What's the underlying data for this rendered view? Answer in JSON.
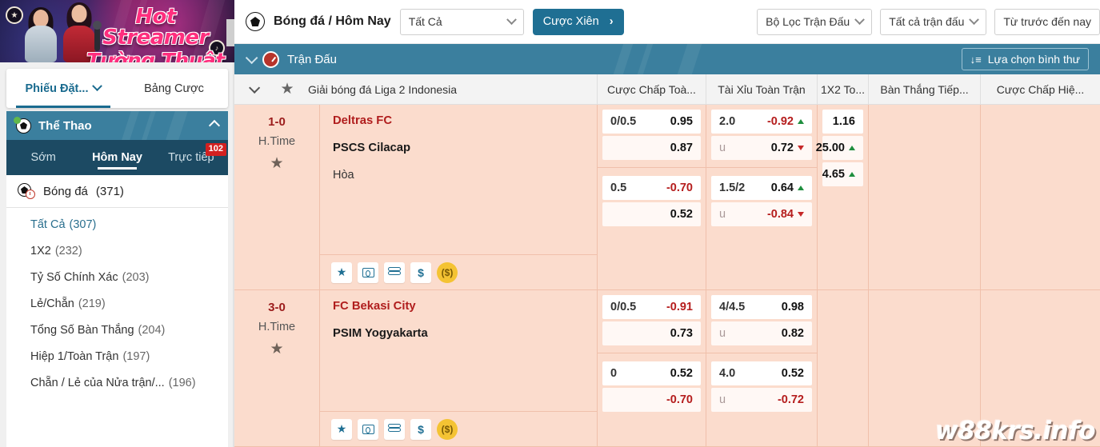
{
  "sidebar": {
    "banner": {
      "line1": "Hot Streamer",
      "line2": "Tường Thuật"
    },
    "betslip": {
      "active_tab": "Phiếu Đặt...",
      "other_tab": "Bảng Cược"
    },
    "sport_header": {
      "title": "Thể Thao",
      "collapse_icon": "chevron-up-icon"
    },
    "sub_tabs": [
      {
        "label": "Sớm",
        "active": false,
        "badge": ""
      },
      {
        "label": "Hôm Nay",
        "active": true,
        "badge": ""
      },
      {
        "label": "Trực tiếp",
        "active": false,
        "badge": "102"
      }
    ],
    "sport_row": {
      "label": "Bóng đá",
      "count": "(371)"
    },
    "menu": [
      {
        "label": "Tất Cả",
        "count": "(307)"
      },
      {
        "label": "1X2",
        "count": "(232)"
      },
      {
        "label": "Tỷ Số Chính Xác",
        "count": "(203)"
      },
      {
        "label": "Lẻ/Chẵn",
        "count": "(219)"
      },
      {
        "label": "Tổng Số Bàn Thắng",
        "count": "(204)"
      },
      {
        "label": "Hiệp 1/Toàn Trận",
        "count": "(197)"
      },
      {
        "label": "Chẵn / Lẻ của Nửa trận/...",
        "count": "(196)"
      }
    ]
  },
  "topbar": {
    "breadcrumb": "Bóng đá / Hôm Nay",
    "select_all": "Tất Cả",
    "parlay_button": "Cược Xiên",
    "filter_match": "Bộ Lọc Trận Đấu",
    "filter_all_matches": "Tất cả trận đấu",
    "filter_time": "Từ trước đến nay"
  },
  "match_bar": {
    "title": "Trận Đấu",
    "normal_option_button": "Lựa chọn bình thư"
  },
  "column_headers": {
    "league": "Giải bóng đá Liga 2 Indonesia",
    "cols": [
      "Cược Chấp Toà...",
      "Tài Xỉu Toàn Trận",
      "1X2 To...",
      "Bàn Thắng Tiếp...",
      "Cược Chấp Hiệ..."
    ]
  },
  "matches": [
    {
      "score": "1-0",
      "period": "H.Time",
      "home": "Deltras FC",
      "away": "PSCS Cilacap",
      "draw": "Hòa",
      "handicap": {
        "top": {
          "line": "0/0.5",
          "odd": "0.95",
          "negative": false,
          "trend": ""
        },
        "bottom": {
          "line": "",
          "odd": "0.87",
          "negative": false,
          "trend": ""
        },
        "top2": {
          "line": "0.5",
          "odd": "-0.70",
          "negative": true,
          "trend": ""
        },
        "bottom2": {
          "line": "",
          "odd": "0.52",
          "negative": false,
          "trend": ""
        }
      },
      "overunder": {
        "top": {
          "line": "2.0",
          "odd": "-0.92",
          "negative": true,
          "trend": "up"
        },
        "bottom": {
          "line": "u",
          "odd": "0.72",
          "negative": false,
          "trend": "down"
        },
        "top2": {
          "line": "1.5/2",
          "odd": "0.64",
          "negative": false,
          "trend": "up"
        },
        "bottom2": {
          "line": "u",
          "odd": "-0.84",
          "negative": true,
          "trend": "down"
        }
      },
      "x12": [
        {
          "odd": "1.16",
          "trend": ""
        },
        {
          "odd": "25.00",
          "trend": "up"
        },
        {
          "odd": "4.65",
          "trend": "up"
        }
      ],
      "actions": [
        "star-icon",
        "pitch-icon",
        "stats-icon",
        "dollar-icon",
        "cashout-coin-icon"
      ]
    },
    {
      "score": "3-0",
      "period": "H.Time",
      "home": "FC Bekasi City",
      "away": "PSIM Yogyakarta",
      "draw": "",
      "handicap": {
        "top": {
          "line": "0/0.5",
          "odd": "-0.91",
          "negative": true,
          "trend": ""
        },
        "bottom": {
          "line": "",
          "odd": "0.73",
          "negative": false,
          "trend": ""
        },
        "top2": {
          "line": "0",
          "odd": "0.52",
          "negative": false,
          "trend": ""
        },
        "bottom2": {
          "line": "",
          "odd": "-0.70",
          "negative": true,
          "trend": ""
        }
      },
      "overunder": {
        "top": {
          "line": "4/4.5",
          "odd": "0.98",
          "negative": false,
          "trend": ""
        },
        "bottom": {
          "line": "u",
          "odd": "0.82",
          "negative": false,
          "trend": ""
        },
        "top2": {
          "line": "4.0",
          "odd": "0.52",
          "negative": false,
          "trend": ""
        },
        "bottom2": {
          "line": "u",
          "odd": "-0.72",
          "negative": true,
          "trend": ""
        }
      },
      "x12": [],
      "actions": [
        "star-icon",
        "pitch-icon",
        "stats-icon",
        "dollar-icon",
        "cashout-coin-icon"
      ]
    }
  ],
  "watermark": "w88krs.info"
}
